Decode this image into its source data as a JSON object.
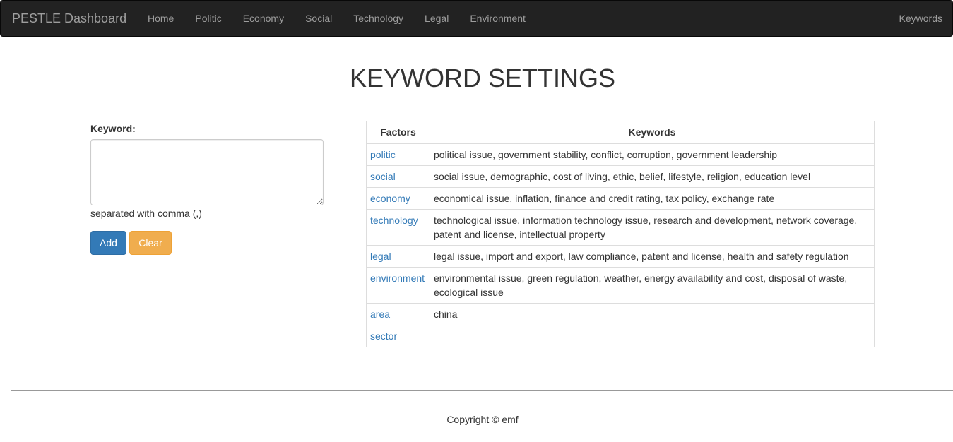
{
  "navbar": {
    "brand": "PESTLE Dashboard",
    "items": [
      "Home",
      "Politic",
      "Economy",
      "Social",
      "Technology",
      "Legal",
      "Environment"
    ],
    "right": "Keywords"
  },
  "page": {
    "title": "KEYWORD SETTINGS"
  },
  "form": {
    "label": "Keyword:",
    "textarea_value": "",
    "help": "separated with comma (,)",
    "add_label": "Add",
    "clear_label": "Clear"
  },
  "table": {
    "headers": [
      "Factors",
      "Keywords"
    ],
    "rows": [
      {
        "factor": "politic",
        "keywords": "political issue, government stability, conflict, corruption, government leadership"
      },
      {
        "factor": "social",
        "keywords": "social issue, demographic, cost of living, ethic, belief, lifestyle, religion, education level"
      },
      {
        "factor": "economy",
        "keywords": "economical issue, inflation, finance and credit rating, tax policy, exchange rate"
      },
      {
        "factor": "technology",
        "keywords": "technological issue, information technology issue, research and development, network coverage, patent and license, intellectual property"
      },
      {
        "factor": "legal",
        "keywords": "legal issue, import and export, law compliance, patent and license, health and safety regulation"
      },
      {
        "factor": "environment",
        "keywords": "environmental issue, green regulation, weather, energy availability and cost, disposal of waste, ecological issue"
      },
      {
        "factor": "area",
        "keywords": "china"
      },
      {
        "factor": "sector",
        "keywords": ""
      }
    ]
  },
  "footer": {
    "text": "Copyright © emf"
  },
  "colors": {
    "navbar_bg": "#222222",
    "link": "#337ab7",
    "primary": "#337ab7",
    "warning": "#f0ad4e"
  }
}
